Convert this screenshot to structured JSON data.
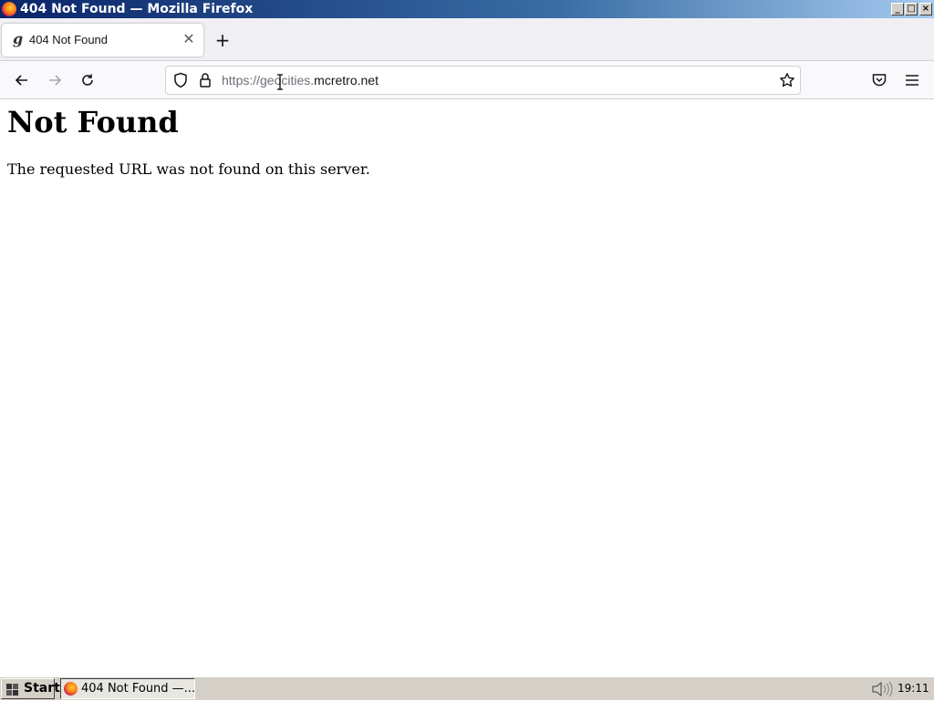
{
  "window": {
    "title": "404 Not Found — Mozilla Firefox",
    "buttons": {
      "minimize": "_",
      "maximize": "□",
      "close": "×"
    }
  },
  "tabs": [
    {
      "title": "404 Not Found",
      "favicon": "g",
      "active": true
    }
  ],
  "toolbar": {
    "new_tab_label": "+",
    "url_prefix": "https://geocities.",
    "url_domain": "mcretro.net"
  },
  "page": {
    "heading": "Not Found",
    "message": "The requested URL was not found on this server."
  },
  "taskbar": {
    "start_label": "Start",
    "task_label": "404 Not Found —...",
    "clock": "19:11"
  },
  "icons": {
    "app": "firefox-icon",
    "back": "arrow-left-icon",
    "forward": "arrow-right-icon",
    "reload": "reload-icon",
    "shield": "shield-icon",
    "lock": "lock-icon",
    "bookmark": "star-icon",
    "pocket": "pocket-icon",
    "menu": "hamburger-menu-icon",
    "speaker": "speaker-icon"
  },
  "colors": {
    "titlebar_start": "#0a246a",
    "titlebar_end": "#a6caf0",
    "taskbar": "#d4d0c8"
  }
}
